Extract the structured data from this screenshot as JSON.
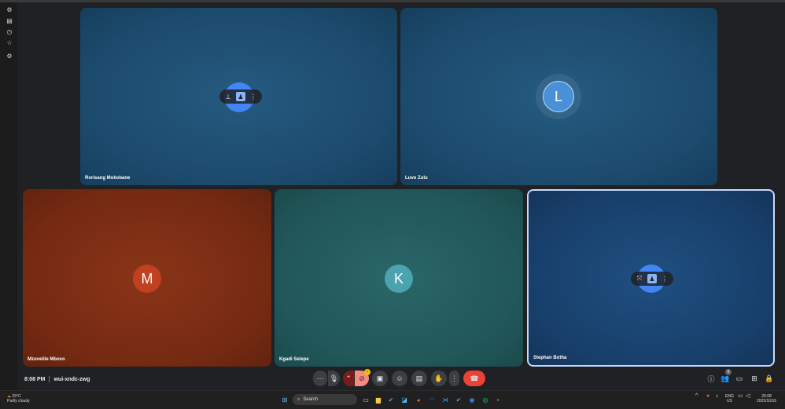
{
  "participants": [
    {
      "name": "Rorisang Mokobane",
      "initial": "",
      "bg": "#1f4f72"
    },
    {
      "name": "Luvo Zulu",
      "initial": "L",
      "bg": "#1f4f72",
      "avatar_color": "#4a90d9"
    },
    {
      "name": "Mzuvelile Mboxo",
      "initial": "M",
      "bg": "#7a2a12",
      "avatar_color": "#c1401f"
    },
    {
      "name": "Kgadi Selepe",
      "initial": "K",
      "bg": "#1f5a5c",
      "avatar_color": "#4aa3ad"
    },
    {
      "name": "Stephan Botha",
      "initial": "",
      "bg": "#173f6b"
    }
  ],
  "meeting": {
    "time": "8:08 PM",
    "code": "wui-xndc-zwg"
  },
  "controls": {
    "more_label": "⋯",
    "camera_badge": "!",
    "people_count": "5"
  },
  "taskbar": {
    "weather_temp": "29°C",
    "weather_desc": "Partly cloudy",
    "search_label": "Search",
    "lang_top": "ENG",
    "lang_bottom": "US",
    "time": "20:08",
    "date": "2025/10/16"
  },
  "colors": {
    "accent": "#8ab4f8",
    "end_call": "#ea4335",
    "camera_off": "#f28b82",
    "speaking_border": "#c6dafc"
  }
}
